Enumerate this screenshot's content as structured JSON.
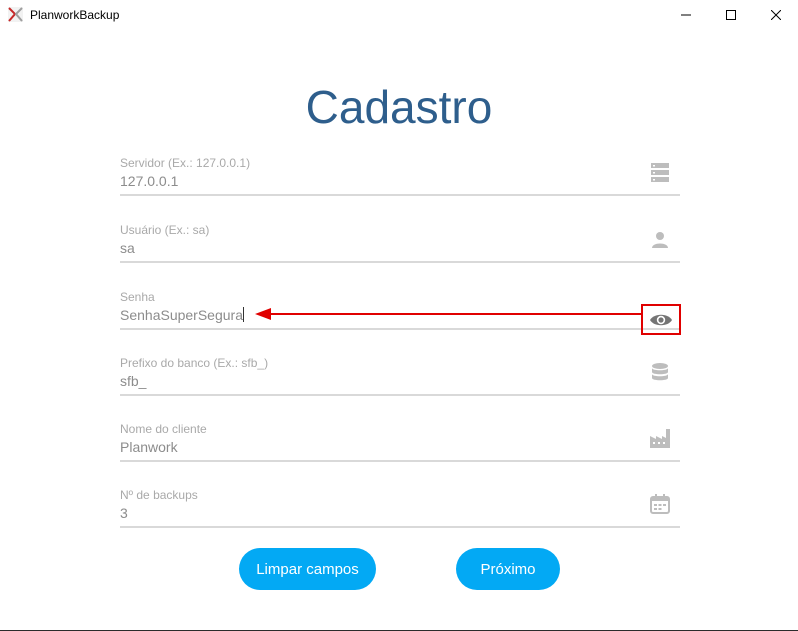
{
  "window": {
    "title": "PlanworkBackup",
    "controls": [
      "minimize",
      "maximize",
      "close"
    ]
  },
  "heading": "Cadastro",
  "fields": [
    {
      "label": "Servidor (Ex.: 127.0.0.1)",
      "value": "127.0.0.1",
      "icon": "server-icon"
    },
    {
      "label": "Usuário (Ex.: sa)",
      "value": "sa",
      "icon": "user-icon"
    },
    {
      "label": "Senha",
      "value": "SenhaSuperSegura",
      "icon": "eye-icon",
      "focused": true
    },
    {
      "label": "Prefixo do banco (Ex.: sfb_)",
      "value": "sfb_",
      "icon": "database-icon"
    },
    {
      "label": "Nome do cliente",
      "value": "Planwork",
      "icon": "factory-icon"
    },
    {
      "label": "Nº de backups",
      "value": "3",
      "icon": "calendar-icon"
    }
  ],
  "buttons": {
    "clear": "Limpar campos",
    "next": "Próximo"
  },
  "colors": {
    "heading": "#2e5e8c",
    "button": "#03a9f4",
    "annotation": "#e00000"
  }
}
